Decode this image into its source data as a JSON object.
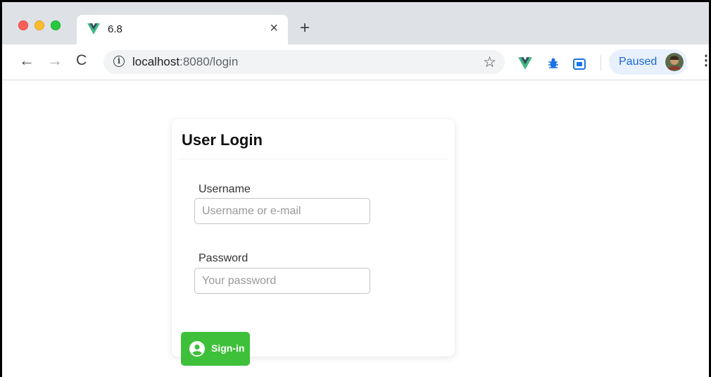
{
  "browser": {
    "tab": {
      "title": "6.8",
      "close_glyph": "×",
      "favicon": "vue-logo-icon"
    },
    "new_tab_glyph": "+",
    "nav": {
      "back_glyph": "←",
      "forward_glyph": "→",
      "reload_glyph": "C"
    },
    "address": {
      "info_glyph": "i",
      "host": "localhost",
      "rest": ":8080/login",
      "star_glyph": "☆"
    },
    "extensions": [
      "vue-devtools-icon",
      "bug-icon",
      "tab-box-icon"
    ],
    "profile": {
      "status": "Paused"
    },
    "menu_glyph": "⋮"
  },
  "login": {
    "title": "User Login",
    "username_label": "Username",
    "username_placeholder": "Username or e-mail",
    "username_value": "",
    "password_label": "Password",
    "password_placeholder": "Your password",
    "password_value": "",
    "submit_label": "Sign-in"
  },
  "colors": {
    "tabstrip": "#dee1e6",
    "signin_button": "#3ec03b",
    "paused_chip": "#e8f0fe",
    "vue_green": "#41b883",
    "vue_dark": "#35495e"
  }
}
